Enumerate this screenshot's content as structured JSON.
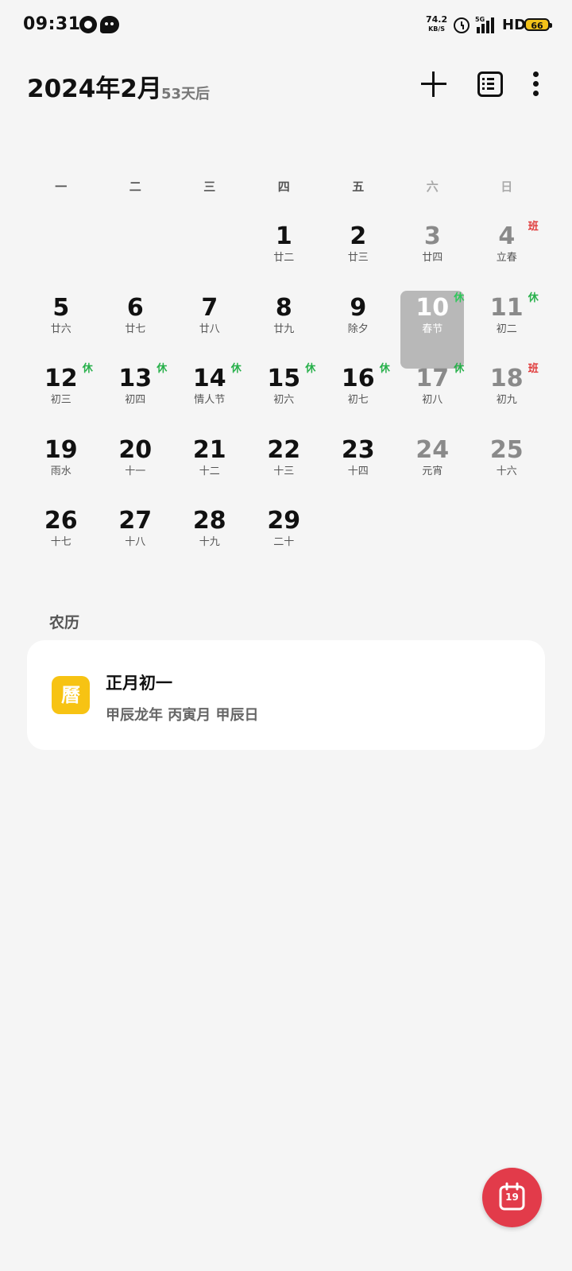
{
  "status_bar": {
    "time": "09:31",
    "net_speed": "74.2",
    "net_unit": "KB/S",
    "network": "5G",
    "hd": "HD",
    "battery": "66"
  },
  "header": {
    "title": "2024年2月",
    "subtitle": "53天后"
  },
  "weekdays": [
    "一",
    "二",
    "三",
    "四",
    "五",
    "六",
    "日"
  ],
  "days": [
    {
      "n": "1",
      "l": "廿二",
      "c": 3,
      "r": 0,
      "tag": "",
      "we": false
    },
    {
      "n": "2",
      "l": "廿三",
      "c": 4,
      "r": 0,
      "tag": "",
      "we": false
    },
    {
      "n": "3",
      "l": "廿四",
      "c": 5,
      "r": 0,
      "tag": "",
      "we": true
    },
    {
      "n": "4",
      "l": "立春",
      "c": 6,
      "r": 0,
      "tag": "班",
      "we": true
    },
    {
      "n": "5",
      "l": "廿六",
      "c": 0,
      "r": 1,
      "tag": "",
      "we": false
    },
    {
      "n": "6",
      "l": "廿七",
      "c": 1,
      "r": 1,
      "tag": "",
      "we": false
    },
    {
      "n": "7",
      "l": "廿八",
      "c": 2,
      "r": 1,
      "tag": "",
      "we": false
    },
    {
      "n": "8",
      "l": "廿九",
      "c": 3,
      "r": 1,
      "tag": "",
      "we": false
    },
    {
      "n": "9",
      "l": "除夕",
      "c": 4,
      "r": 1,
      "tag": "",
      "we": false
    },
    {
      "n": "10",
      "l": "春节",
      "c": 5,
      "r": 1,
      "tag": "休",
      "we": true,
      "selected": true
    },
    {
      "n": "11",
      "l": "初二",
      "c": 6,
      "r": 1,
      "tag": "休",
      "we": true
    },
    {
      "n": "12",
      "l": "初三",
      "c": 0,
      "r": 2,
      "tag": "休",
      "we": false
    },
    {
      "n": "13",
      "l": "初四",
      "c": 1,
      "r": 2,
      "tag": "休",
      "we": false
    },
    {
      "n": "14",
      "l": "情人节",
      "c": 2,
      "r": 2,
      "tag": "休",
      "we": false
    },
    {
      "n": "15",
      "l": "初六",
      "c": 3,
      "r": 2,
      "tag": "休",
      "we": false
    },
    {
      "n": "16",
      "l": "初七",
      "c": 4,
      "r": 2,
      "tag": "休",
      "we": false
    },
    {
      "n": "17",
      "l": "初八",
      "c": 5,
      "r": 2,
      "tag": "休",
      "we": true
    },
    {
      "n": "18",
      "l": "初九",
      "c": 6,
      "r": 2,
      "tag": "班",
      "we": true
    },
    {
      "n": "19",
      "l": "雨水",
      "c": 0,
      "r": 3,
      "tag": "",
      "we": false
    },
    {
      "n": "20",
      "l": "十一",
      "c": 1,
      "r": 3,
      "tag": "",
      "we": false
    },
    {
      "n": "21",
      "l": "十二",
      "c": 2,
      "r": 3,
      "tag": "",
      "we": false
    },
    {
      "n": "22",
      "l": "十三",
      "c": 3,
      "r": 3,
      "tag": "",
      "we": false
    },
    {
      "n": "23",
      "l": "十四",
      "c": 4,
      "r": 3,
      "tag": "",
      "we": false
    },
    {
      "n": "24",
      "l": "元宵",
      "c": 5,
      "r": 3,
      "tag": "",
      "we": true
    },
    {
      "n": "25",
      "l": "十六",
      "c": 6,
      "r": 3,
      "tag": "",
      "we": true
    },
    {
      "n": "26",
      "l": "十七",
      "c": 0,
      "r": 4,
      "tag": "",
      "we": false
    },
    {
      "n": "27",
      "l": "十八",
      "c": 1,
      "r": 4,
      "tag": "",
      "we": false
    },
    {
      "n": "28",
      "l": "十九",
      "c": 2,
      "r": 4,
      "tag": "",
      "we": false
    },
    {
      "n": "29",
      "l": "二十",
      "c": 3,
      "r": 4,
      "tag": "",
      "we": false
    }
  ],
  "lunar_section": {
    "title": "农历",
    "icon_text": "曆",
    "date": "正月初一",
    "ganzhi": "甲辰龙年 丙寅月 甲辰日"
  },
  "fab": {
    "day": "19"
  },
  "colors": {
    "rest": "#27b04a",
    "work": "#e03a3a",
    "fab": "#e23b4a",
    "almanac_icon": "#f7c313",
    "selected_bg": "#b8b8b8"
  }
}
